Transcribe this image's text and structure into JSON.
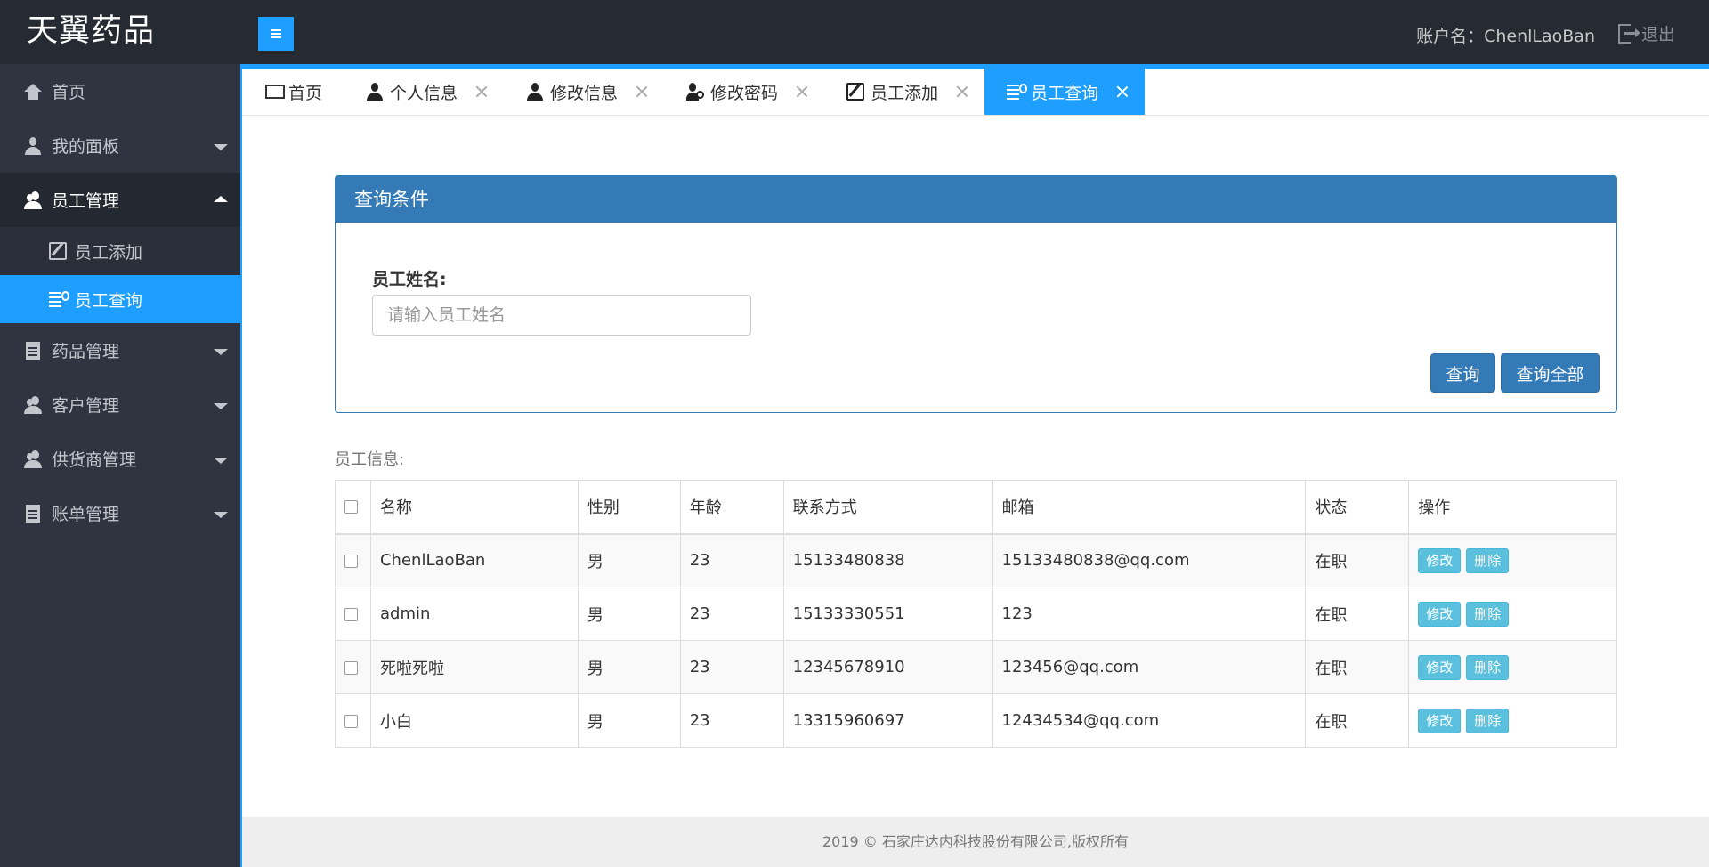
{
  "header": {
    "logo": "天翼药品",
    "account_text": "账户名：ChenlLaoBan",
    "logout_label": "退出"
  },
  "sidebar": {
    "items": [
      {
        "label": "首页"
      },
      {
        "label": "我的面板"
      },
      {
        "label": "员工管理"
      },
      {
        "label": "员工添加"
      },
      {
        "label": "员工查询"
      },
      {
        "label": "药品管理"
      },
      {
        "label": "客户管理"
      },
      {
        "label": "供货商管理"
      },
      {
        "label": "账单管理"
      }
    ]
  },
  "tabs": [
    {
      "label": "首页"
    },
    {
      "label": "个人信息"
    },
    {
      "label": "修改信息"
    },
    {
      "label": "修改密码"
    },
    {
      "label": "员工添加"
    },
    {
      "label": "员工查询"
    }
  ],
  "query": {
    "title": "查询条件",
    "name_label": "员工姓名:",
    "name_placeholder": "请输入员工姓名",
    "query_button": "查询",
    "query_all_button": "查询全部"
  },
  "employees": {
    "section_title": "员工信息:",
    "columns": [
      "名称",
      "性别",
      "年龄",
      "联系方式",
      "邮箱",
      "状态",
      "操作"
    ],
    "rows": [
      {
        "name": "ChenlLaoBan",
        "gender": "男",
        "age": "23",
        "phone": "15133480838",
        "email": "15133480838@qq.com",
        "status": "在职"
      },
      {
        "name": "admin",
        "gender": "男",
        "age": "23",
        "phone": "15133330551",
        "email": "123",
        "status": "在职"
      },
      {
        "name": "死啦死啦",
        "gender": "男",
        "age": "23",
        "phone": "12345678910",
        "email": "123456@qq.com",
        "status": "在职"
      },
      {
        "name": "小白",
        "gender": "男",
        "age": "23",
        "phone": "13315960697",
        "email": "12434534@qq.com",
        "status": "在职"
      }
    ],
    "edit_label": "修改",
    "delete_label": "删除"
  },
  "footer": {
    "text": "2019 © 石家庄达内科技股份有限公司,版权所有"
  }
}
